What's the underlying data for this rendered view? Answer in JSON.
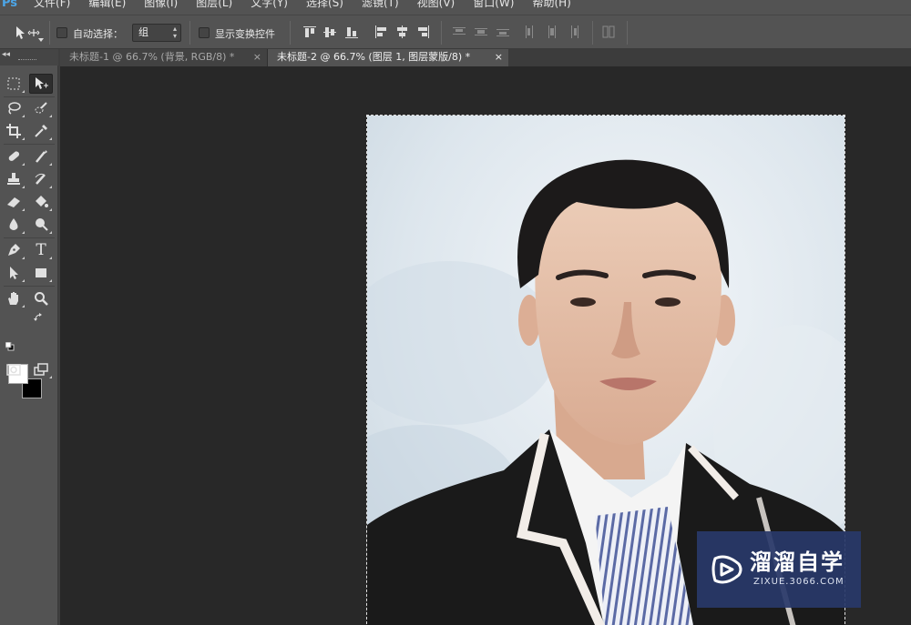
{
  "app": {
    "logo": "Ps"
  },
  "menu": [
    "文件(F)",
    "编辑(E)",
    "图像(I)",
    "图层(L)",
    "文字(Y)",
    "选择(S)",
    "滤镜(T)",
    "视图(V)",
    "窗口(W)",
    "帮助(H)"
  ],
  "options": {
    "tool_icon": "move-tool-icon",
    "auto_select_label": "自动选择：",
    "auto_select_value": "组",
    "show_transform_label": "显示变换控件"
  },
  "tabs": [
    {
      "label": "未标题-1 @ 66.7% (背景, RGB/8) *",
      "close": "×",
      "active": false
    },
    {
      "label": "未标题-2 @ 66.7% (图层 1, 图层蒙版/8) *",
      "close": "×",
      "active": true
    }
  ],
  "toolbox": {
    "collapse": "◂◂",
    "tools": [
      "marquee-icon",
      "move-icon",
      "lasso-icon",
      "quick-select-icon",
      "crop-icon",
      "eyedropper-icon",
      "healing-brush-icon",
      "brush-icon",
      "clone-stamp-icon",
      "history-brush-icon",
      "eraser-icon",
      "paint-bucket-icon",
      "blur-icon",
      "dodge-icon",
      "pen-icon",
      "type-icon",
      "path-select-icon",
      "rectangle-icon",
      "hand-icon",
      "zoom-icon"
    ],
    "type_glyph": "T",
    "foreground_color": "#ffffff",
    "background_color": "#000000"
  },
  "watermark": {
    "title": "溜溜自学",
    "subtitle": "ZIXUE.3066.COM"
  }
}
